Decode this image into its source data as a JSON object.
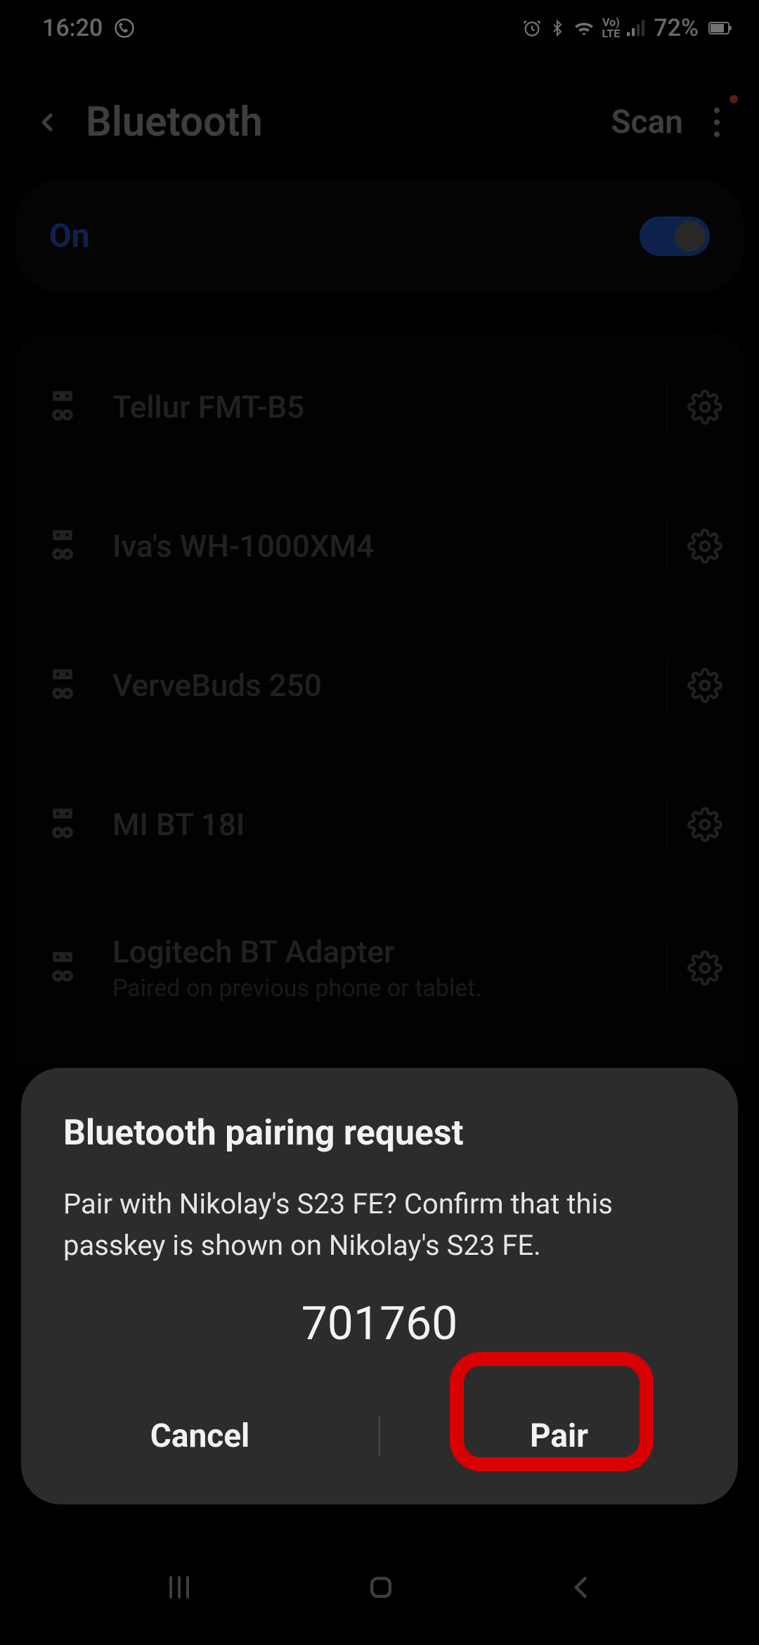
{
  "status": {
    "time": "16:20",
    "battery_text": "72%",
    "battery_level_pct": 72
  },
  "header": {
    "title": "Bluetooth",
    "scan_label": "Scan"
  },
  "toggle": {
    "state_label": "On"
  },
  "devices": [
    {
      "name": "Tellur FMT-B5",
      "sub": null
    },
    {
      "name": "Iva's WH-1000XM4",
      "sub": null
    },
    {
      "name": "VerveBuds 250",
      "sub": null
    },
    {
      "name": "MI BT 18I",
      "sub": null
    },
    {
      "name": "Logitech BT Adapter",
      "sub": "Paired on previous phone or tablet."
    }
  ],
  "dialog": {
    "title": "Bluetooth pairing request",
    "body": "Pair with Nikolay's S23 FE? Confirm that this passkey is shown on Nikolay's S23 FE.",
    "passkey": "701760",
    "cancel_label": "Cancel",
    "pair_label": "Pair"
  }
}
